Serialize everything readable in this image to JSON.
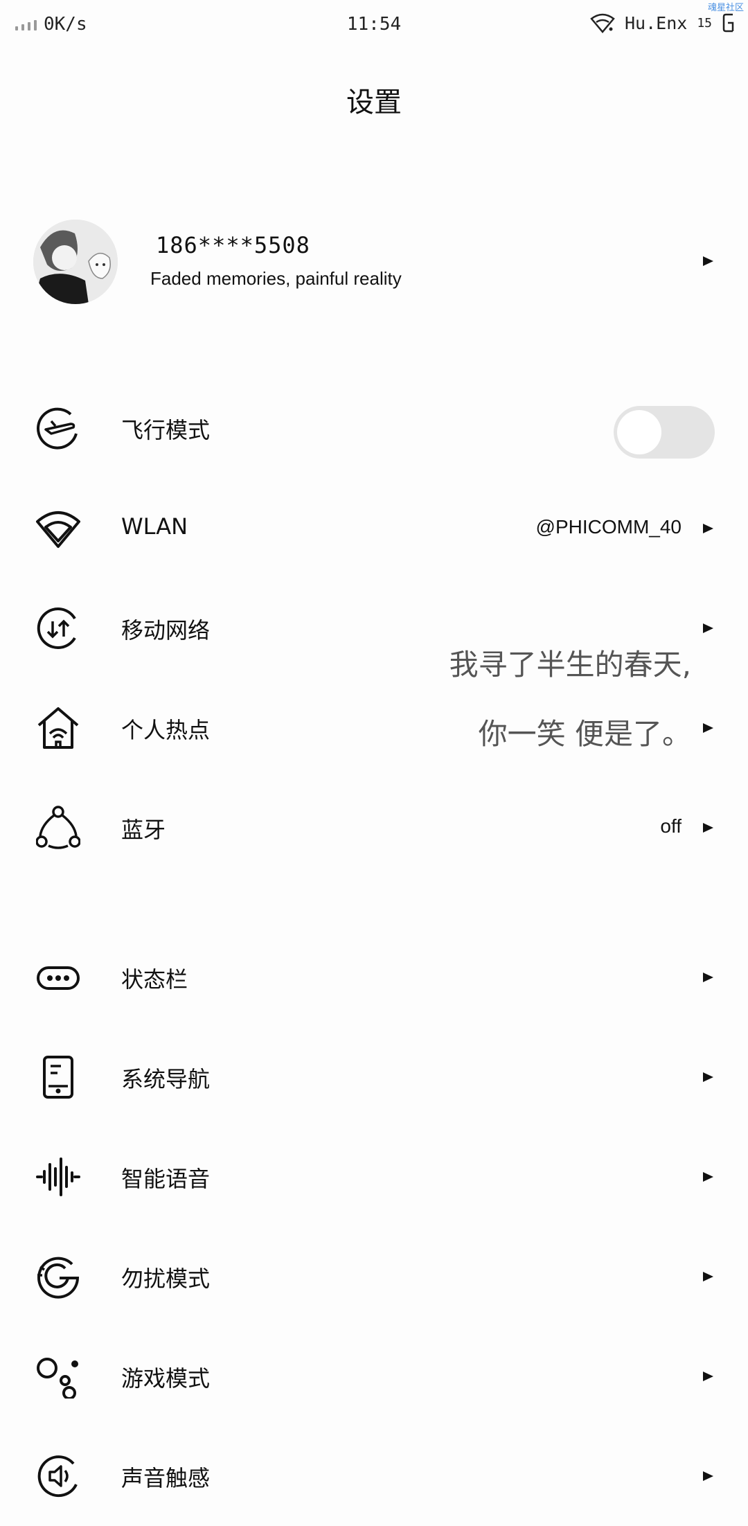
{
  "status_bar": {
    "net_speed": "0K/s",
    "time": "11:54",
    "carrier": "Hu.Enx",
    "signal_num": "15",
    "watermark": "魂星社区"
  },
  "page": {
    "title": "设置"
  },
  "profile": {
    "account": "186****5508",
    "signature": "Faded memories, painful reality"
  },
  "settings": [
    {
      "label": "飞行模式",
      "icon": "airplane-icon",
      "toggle_on": false
    },
    {
      "label": "WLAN",
      "icon": "wifi-icon",
      "value": "@PHICOMM_40"
    },
    {
      "label": "移动网络",
      "icon": "mobile-data-icon"
    },
    {
      "label": "个人热点",
      "icon": "hotspot-icon"
    },
    {
      "label": "蓝牙",
      "icon": "bluetooth-icon",
      "value": "off"
    },
    {
      "label": "状态栏",
      "icon": "status-bar-icon"
    },
    {
      "label": "系统导航",
      "icon": "navigation-icon"
    },
    {
      "label": "智能语音",
      "icon": "voice-icon"
    },
    {
      "label": "勿扰模式",
      "icon": "do-not-disturb-icon"
    },
    {
      "label": "游戏模式",
      "icon": "game-mode-icon"
    },
    {
      "label": "声音触感",
      "icon": "sound-icon"
    }
  ],
  "quote": {
    "line1": "我寻了半生的春天,",
    "line2": "你一笑 便是了。"
  }
}
